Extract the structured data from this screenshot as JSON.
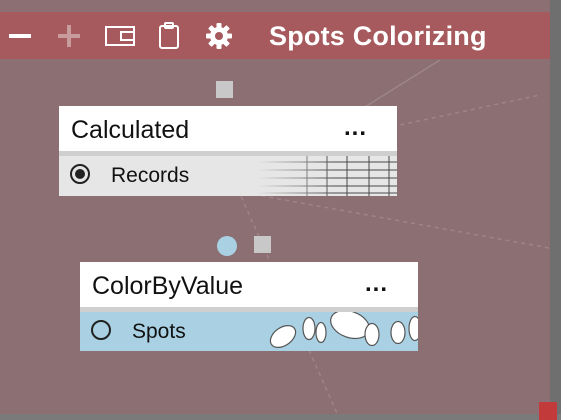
{
  "window": {
    "title": "Spots Colorizing"
  },
  "toolbar": {
    "icons": [
      "minus-icon",
      "plus-icon",
      "wallet-icon",
      "clipboard-icon",
      "gear-icon"
    ]
  },
  "nodes": [
    {
      "title": "Calculated",
      "menu": "...",
      "output": {
        "label": "Records",
        "selected": true
      }
    },
    {
      "title": "ColorByValue",
      "menu": "...",
      "output": {
        "label": "Spots",
        "selected": false
      }
    }
  ],
  "colors": {
    "canvas": "#8b6f72",
    "titlebar": "#a65a5d",
    "port_input": "#c8c8c8",
    "port_link": "#a9d1e3",
    "selected_row": "#e6e6e6",
    "spots_row": "#a9d1e3",
    "corner": "#c33a3a"
  }
}
